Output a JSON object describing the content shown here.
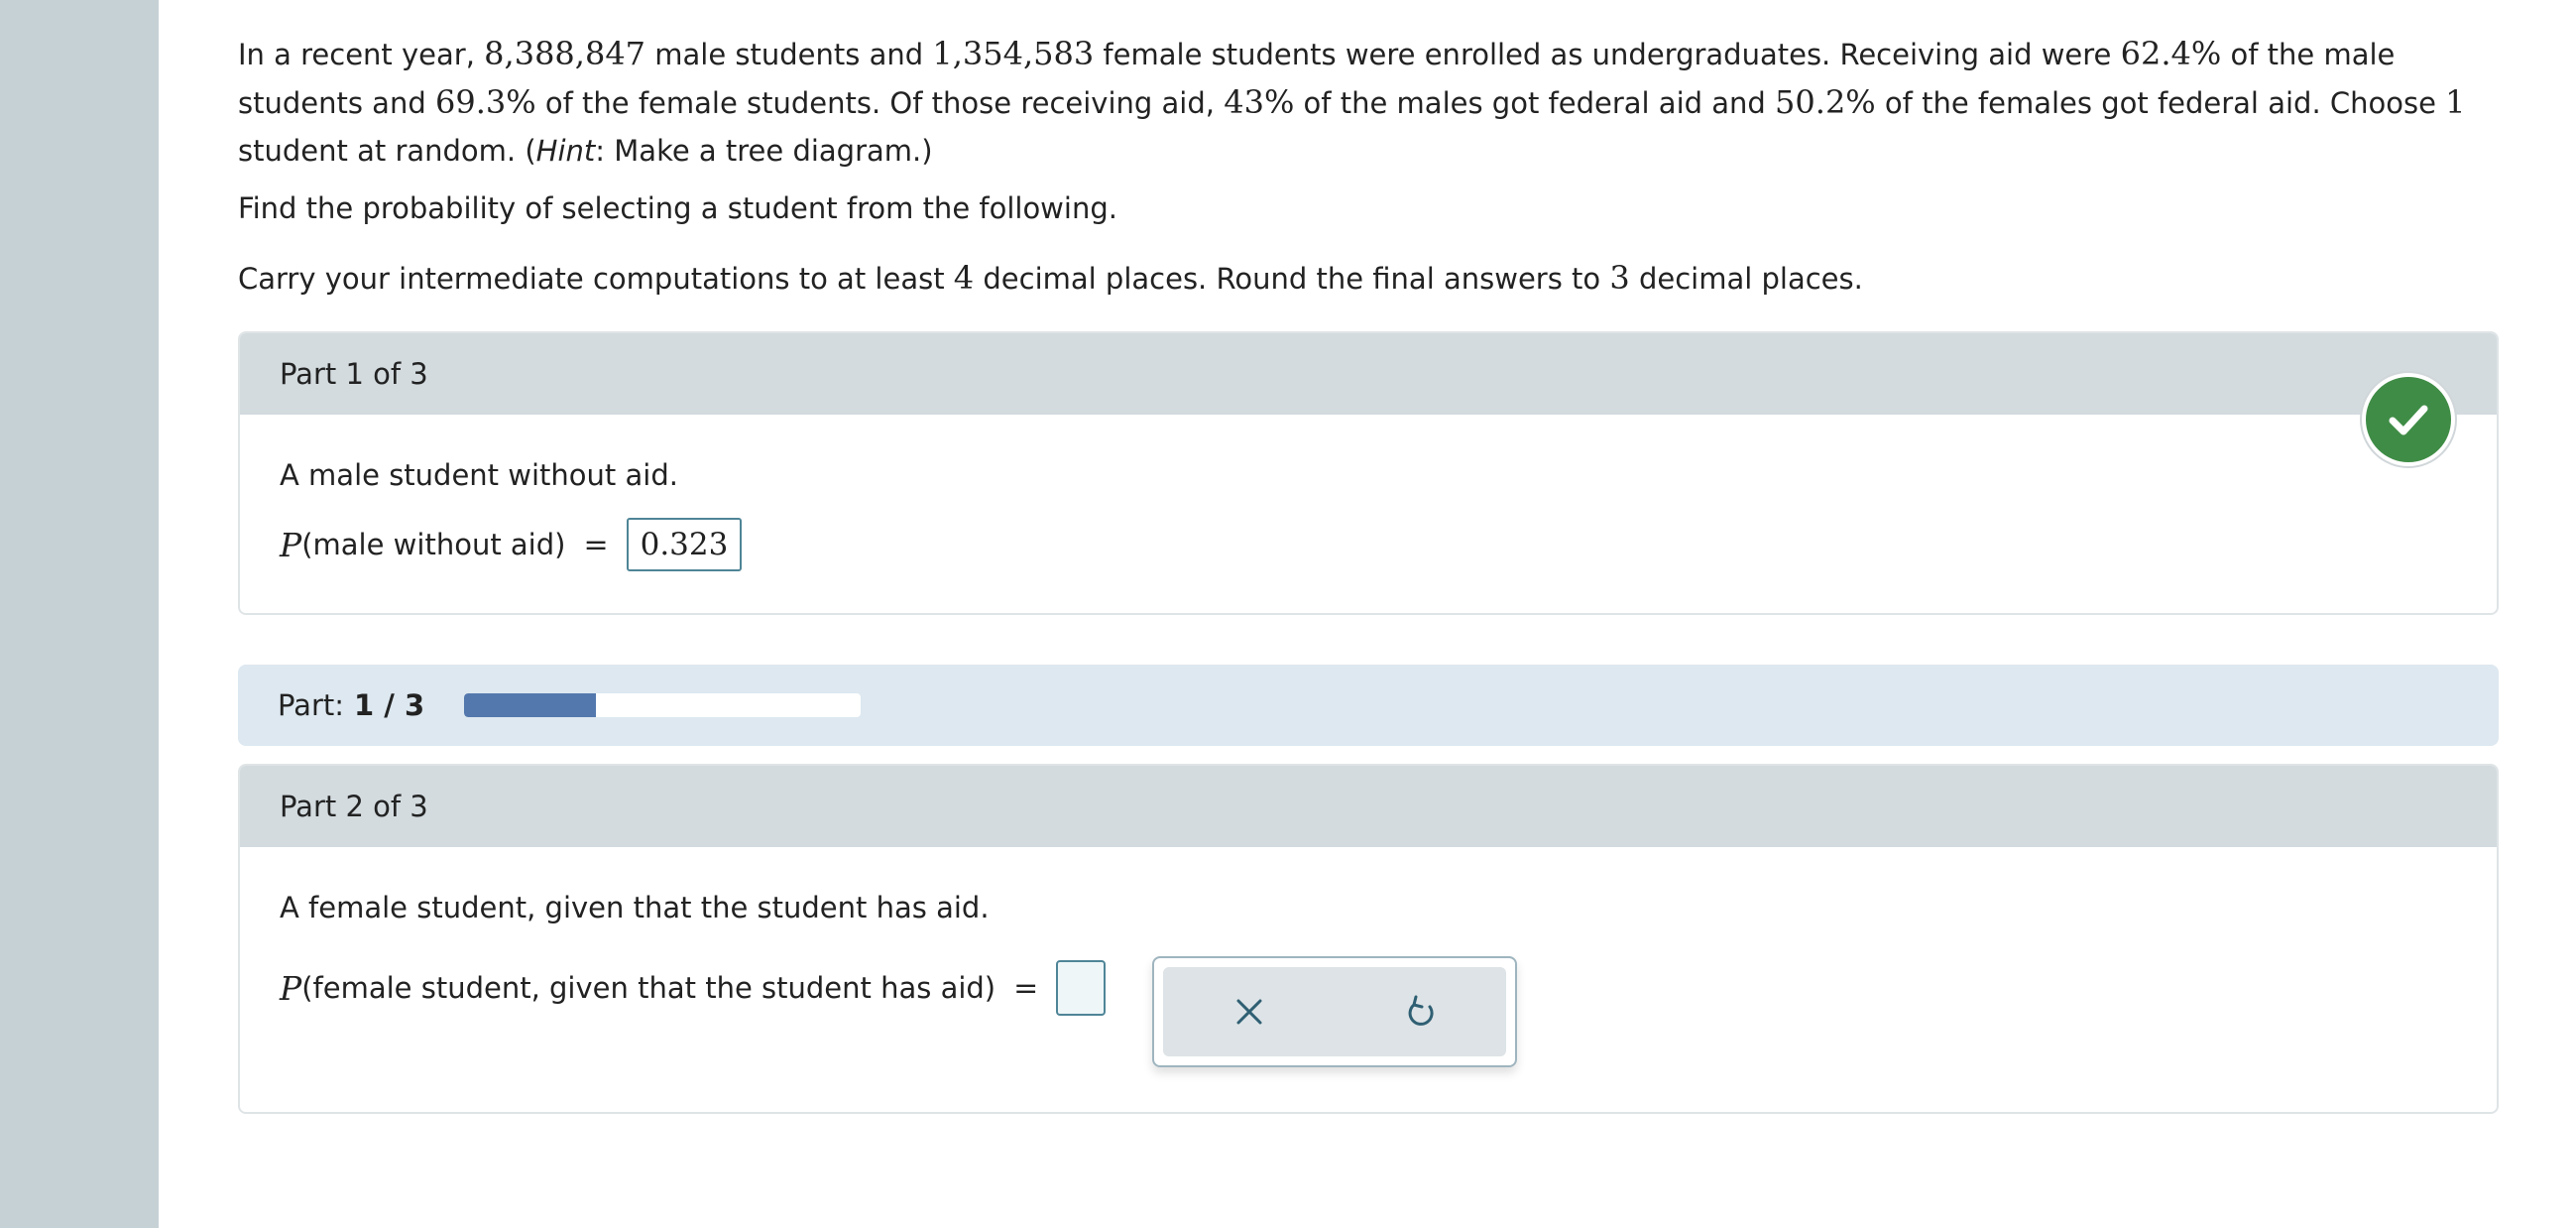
{
  "problem": {
    "seg1": "In a recent year, ",
    "male_count": "8,388,847",
    "seg2": " male students and ",
    "female_count": "1,354,583",
    "seg3": " female students were enrolled as undergraduates. Receiving aid were ",
    "male_aid_pct": "62.4%",
    "seg4": " of the male students and ",
    "female_aid_pct": "69.3%",
    "seg5": " of the female students. Of those receiving aid, ",
    "male_federal_pct": "43%",
    "seg6": " of the males got federal aid and ",
    "female_federal_pct": "50.2%",
    "seg7": " of the females got federal aid. Choose ",
    "choose_count": "1",
    "seg8": " student at random. (",
    "hint_label": "Hint",
    "hint_text": ": Make a tree diagram.)"
  },
  "instructions": {
    "find": "Find the probability of selecting a student from the following.",
    "carry_a": "Carry your intermediate computations to at least ",
    "carry_places": "4",
    "carry_b": " decimal places. Round the final answers to ",
    "round_places": "3",
    "carry_c": " decimal places."
  },
  "part1": {
    "header": "Part 1 of 3",
    "question": "A male student without aid.",
    "p_symbol": "P",
    "p_arg": "(male without aid)",
    "equals": "=",
    "answer": "0.323",
    "status_icon": "checkmark-icon",
    "status_color": "#3f8c46"
  },
  "progress": {
    "label": "Part:",
    "count": "1 / 3",
    "fraction": 0.333,
    "fill_color": "#5378ad"
  },
  "part2": {
    "header": "Part 2 of 3",
    "question": "A female student, given that the student has aid.",
    "p_symbol": "P",
    "p_arg": "(female student, given that the student has aid)",
    "equals": "=",
    "answer": "",
    "tools": {
      "clear_icon": "close-icon",
      "undo_icon": "undo-icon"
    }
  }
}
